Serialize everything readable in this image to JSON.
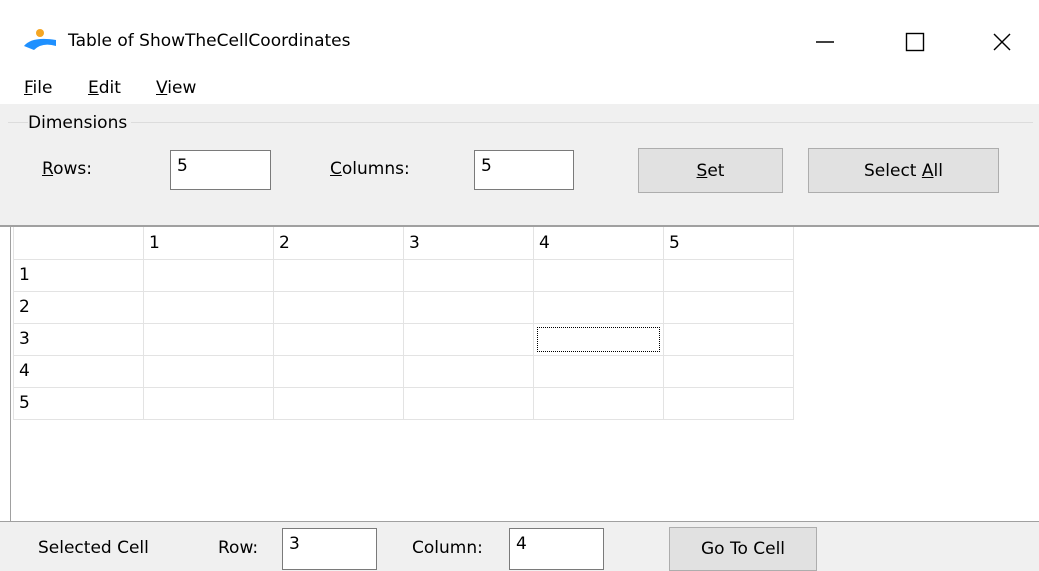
{
  "window": {
    "title": "Table of ShowTheCellCoordinates",
    "controls": {
      "minimize": "—",
      "maximize": "☐",
      "close": "✕"
    }
  },
  "menu": [
    {
      "first": "F",
      "rest": "ile"
    },
    {
      "first": "E",
      "rest": "dit"
    },
    {
      "first": "V",
      "rest": "iew"
    }
  ],
  "dimensions": {
    "group_label": "Dimensions",
    "rows_label_first": "R",
    "rows_label_rest": "ows:",
    "rows_value": "5",
    "columns_label_first": "C",
    "columns_label_rest": "olumns:",
    "columns_value": "5",
    "set_button_first": "S",
    "set_button_rest": "et",
    "select_all_prefix": "Select ",
    "select_all_first": "A",
    "select_all_rest": "ll"
  },
  "grid": {
    "column_headers": [
      "",
      "1",
      "2",
      "3",
      "4",
      "5"
    ],
    "row_headers": [
      "1",
      "2",
      "3",
      "4",
      "5"
    ],
    "focused_cell": {
      "row": 3,
      "column": 4
    }
  },
  "selected": {
    "label": "Selected Cell",
    "row_label": "Row:",
    "row_value": "3",
    "column_label": "Column:",
    "column_value": "4",
    "goto_button": "Go To Cell"
  },
  "colors": {
    "icon_orange": "#f5a623",
    "icon_blue": "#1e90ff",
    "panel": "#f0f0f0",
    "button": "#e1e1e1"
  }
}
